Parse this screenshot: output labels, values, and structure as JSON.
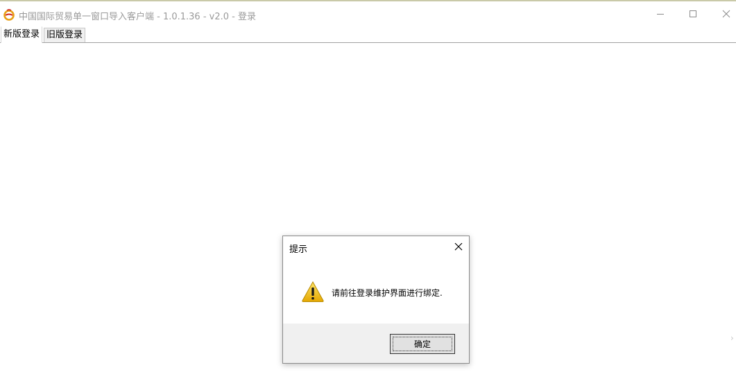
{
  "window": {
    "title": "中国国际贸易单一窗口导入客户端 - 1.0.1.36 - v2.0 - 登录",
    "icon": "app-logo-icon",
    "controls": [
      "minimize-icon",
      "maximize-icon",
      "close-icon"
    ]
  },
  "tabs": [
    {
      "label": "新版登录",
      "active": true
    },
    {
      "label": "旧版登录",
      "active": false
    }
  ],
  "dialog": {
    "title": "提示",
    "message": "请前往登录维护界面进行绑定.",
    "icon": "warning-icon",
    "ok_label": "确定"
  },
  "colors": {
    "title_text": "#9a9a9a",
    "dialog_footer": "#f0f0f0",
    "warning_fill": "#f5c400"
  }
}
